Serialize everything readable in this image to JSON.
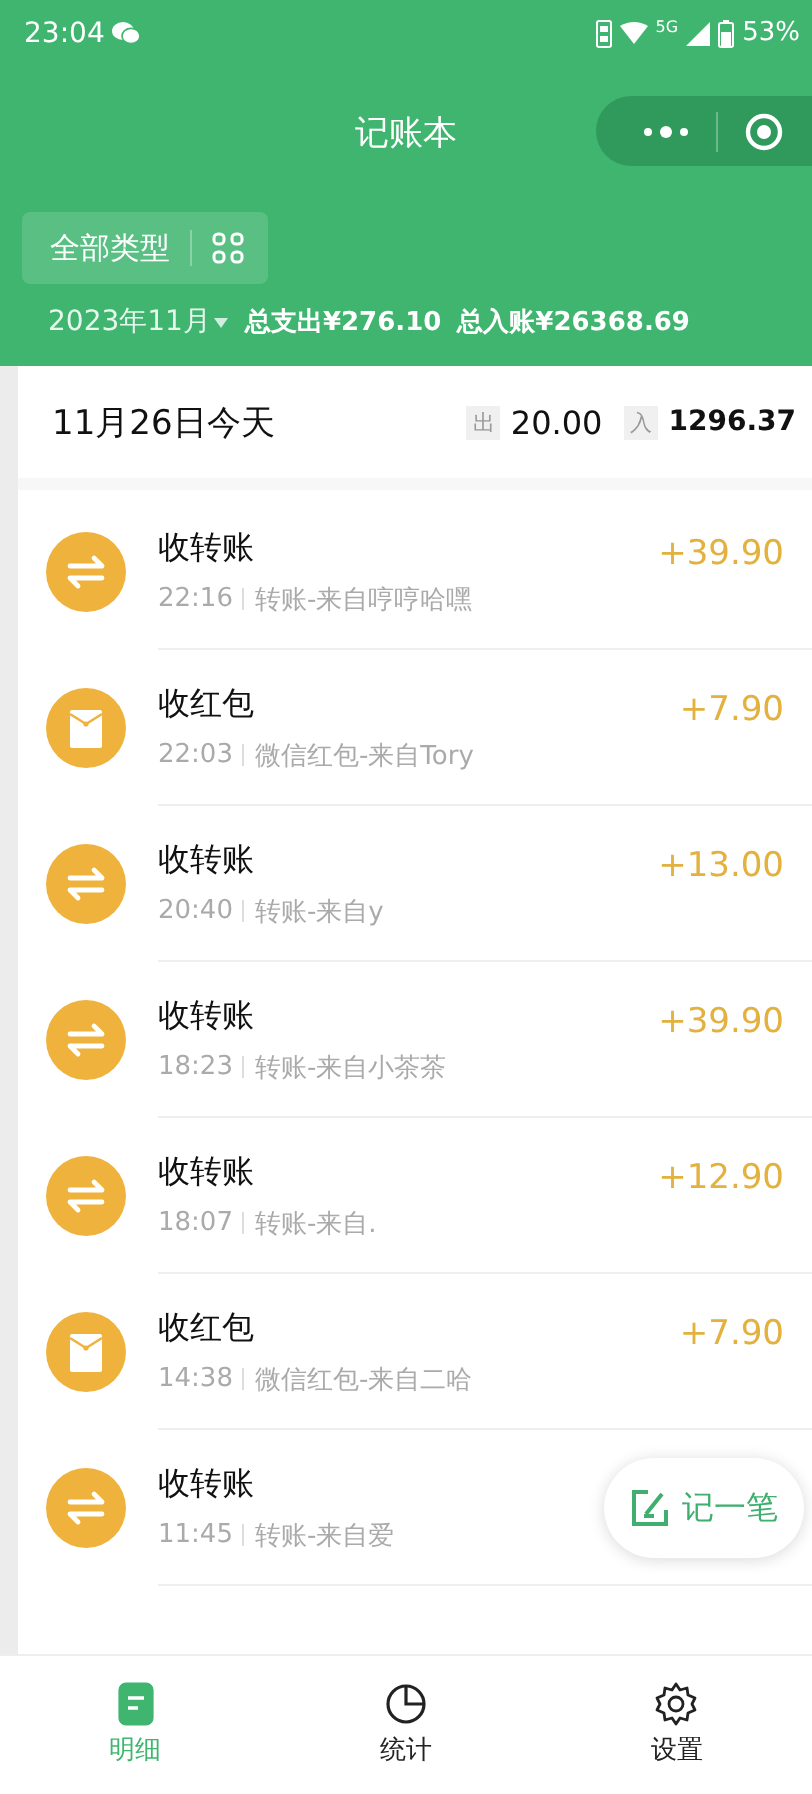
{
  "status_bar": {
    "time": "23:04",
    "battery": "53%",
    "network": "5G"
  },
  "nav": {
    "title": "记账本"
  },
  "filter": {
    "label": "全部类型"
  },
  "summary": {
    "month": "2023年11月",
    "expense": "总支出¥276.10",
    "income": "总入账¥26368.69"
  },
  "day": {
    "date": "11月26日今天",
    "out_label": "出",
    "out_amount": "20.00",
    "in_label": "入",
    "in_amount": "1296.37"
  },
  "records": [
    {
      "kind": "transfer",
      "title": "收转账",
      "time": "22:16",
      "note": "转账-来自哼哼哈嘿",
      "amount": "+39.90"
    },
    {
      "kind": "redpacket",
      "title": "收红包",
      "time": "22:03",
      "note": "微信红包-来自Tory",
      "amount": "+7.90"
    },
    {
      "kind": "transfer",
      "title": "收转账",
      "time": "20:40",
      "note": "转账-来自y",
      "amount": "+13.00"
    },
    {
      "kind": "transfer",
      "title": "收转账",
      "time": "18:23",
      "note": "转账-来自小茶茶",
      "amount": "+39.90"
    },
    {
      "kind": "transfer",
      "title": "收转账",
      "time": "18:07",
      "note": "转账-来自.",
      "amount": "+12.90"
    },
    {
      "kind": "redpacket",
      "title": "收红包",
      "time": "14:38",
      "note": "微信红包-来自二哈",
      "amount": "+7.90"
    },
    {
      "kind": "transfer",
      "title": "收转账",
      "time": "11:45",
      "note": "转账-来自爱"
    }
  ],
  "fab": {
    "label": "记一笔"
  },
  "tabs": [
    {
      "kind": "detail",
      "label": "明细",
      "selected": true
    },
    {
      "kind": "stats",
      "label": "统计",
      "selected": false
    },
    {
      "kind": "settings",
      "label": "设置",
      "selected": false
    }
  ]
}
